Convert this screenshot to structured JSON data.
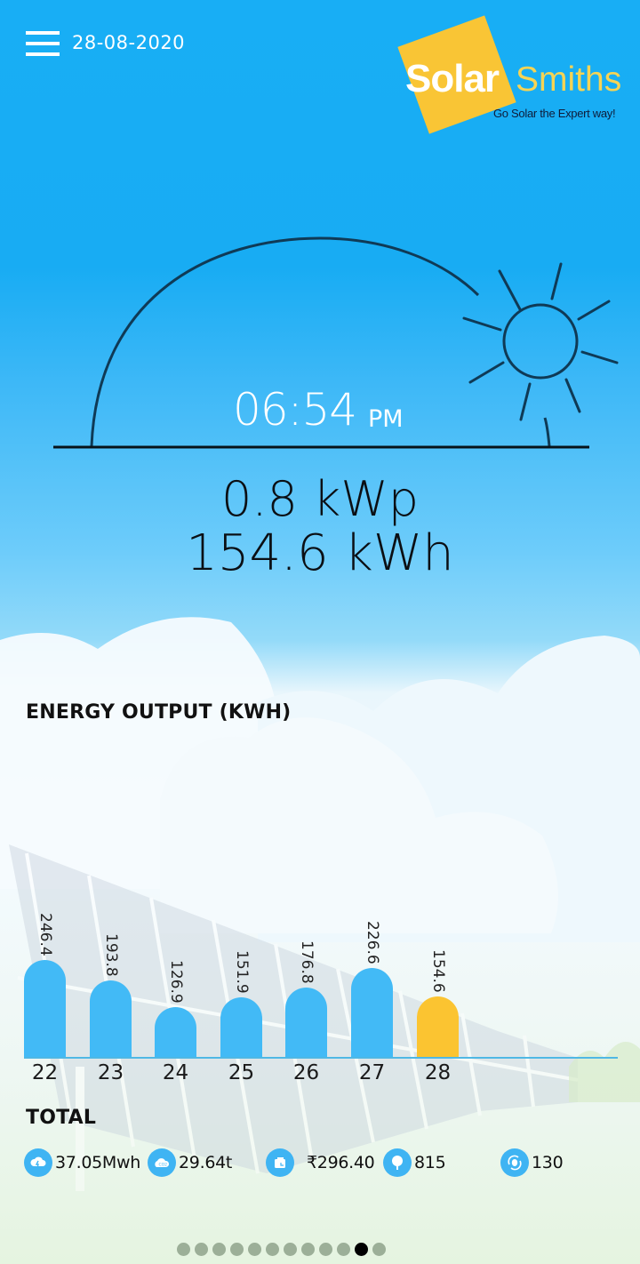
{
  "header": {
    "date": "28-08-2020",
    "menu_icon": "hamburger-menu-icon",
    "logo": {
      "word1": "Solar",
      "word2": "Smiths",
      "tagline": "Go Solar the Expert way!"
    }
  },
  "sun_panel": {
    "time": "06:54",
    "ampm": "PM",
    "power": "0.8 kWp",
    "energy_today": "154.6 kWh"
  },
  "energy_output": {
    "title": "ENERGY OUTPUT (KWH)"
  },
  "chart_data": {
    "type": "bar",
    "title": "ENERGY OUTPUT (KWH)",
    "xlabel": "",
    "ylabel": "",
    "categories": [
      "22",
      "23",
      "24",
      "25",
      "26",
      "27",
      "28"
    ],
    "values": [
      246.4,
      193.8,
      126.9,
      151.9,
      176.8,
      226.6,
      154.6
    ],
    "value_labels": [
      "246.4",
      "193.8",
      "126.9",
      "151.9",
      "176.8",
      "226.6",
      "154.6"
    ],
    "highlight_index": 6,
    "colors": {
      "default": "#42baf6",
      "highlight": "#fbc431",
      "axis": "#4fb8e4"
    },
    "grid": false,
    "legend": "none"
  },
  "totals": {
    "title": "TOTAL",
    "items": [
      {
        "icon": "energy-cloud-icon",
        "value": "37.05Mwh"
      },
      {
        "icon": "co2-cloud-icon",
        "value": "29.64t"
      },
      {
        "icon": "wallet-icon",
        "value": "₹296.40"
      },
      {
        "icon": "tree-icon",
        "value": "815"
      },
      {
        "icon": "recycle-coin-icon",
        "value": "130"
      }
    ]
  },
  "pager": {
    "count": 12,
    "active_index": 10
  }
}
